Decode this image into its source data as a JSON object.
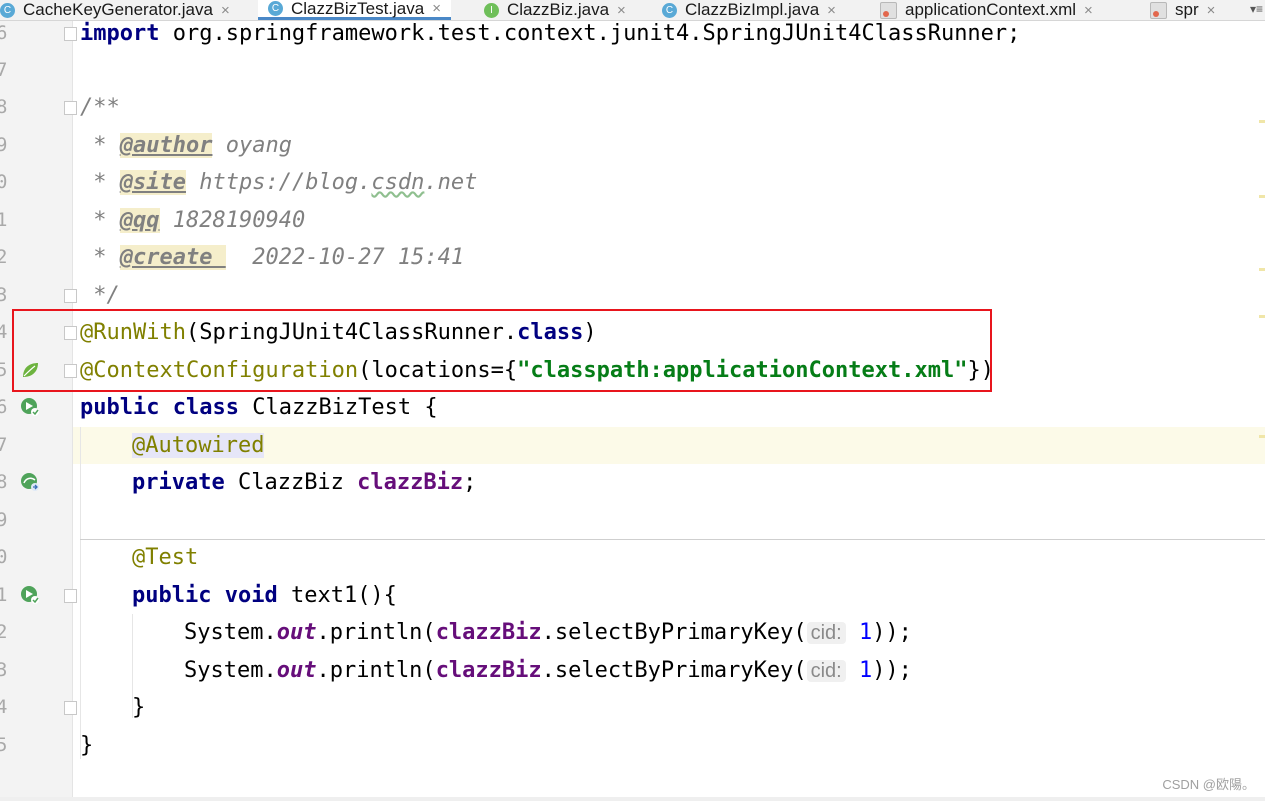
{
  "tabs": [
    {
      "label": "CacheKeyGenerator.java",
      "icon": "class-icon",
      "active": false
    },
    {
      "label": "ClazzBizTest.java",
      "icon": "class-icon",
      "active": true
    },
    {
      "label": "ClazzBiz.java",
      "icon": "interface-icon",
      "active": false
    },
    {
      "label": "ClazzBizImpl.java",
      "icon": "class-icon",
      "active": false
    },
    {
      "label": "applicationContext.xml",
      "icon": "xml-icon",
      "active": false
    },
    {
      "label": "spr",
      "icon": "xml-icon",
      "active": false
    }
  ],
  "tab_close_glyph": "×",
  "tab_menu_glyph": "▾≡",
  "line_numbers": [
    "6",
    "7",
    "8",
    "9",
    "0",
    "1",
    "2",
    "3",
    "4",
    "5",
    "6",
    "7",
    "8",
    "9",
    "0",
    "1",
    "2",
    "3",
    "4",
    "5"
  ],
  "code": {
    "l6": {
      "kw": "import",
      "rest": " org.springframework.test.context.junit4.SpringJUnit4ClassRunner;"
    },
    "l8": "/**",
    "l9": {
      "star": " * ",
      "tag": "@author",
      "val": " oyang"
    },
    "l10": {
      "star": " * ",
      "tag": "@site",
      "val": " https://blog.",
      "wavy": "csdn",
      "val2": ".net"
    },
    "l11": {
      "star": " * ",
      "tag": "@qq",
      "val": " 1828190940"
    },
    "l12": {
      "star": " * ",
      "tag": "@create ",
      "val": "  2022-10-27 15:41"
    },
    "l13": " */",
    "l14": {
      "ann": "@RunWith",
      "p1": "(SpringJUnit4ClassRunner.",
      "kw": "class",
      "p2": ")"
    },
    "l15": {
      "ann": "@ContextConfiguration",
      "p1": "(locations={",
      "str": "\"classpath:applicationContext.xml\"",
      "p2": "})"
    },
    "l16": {
      "kw1": "public",
      "kw2": "class",
      "rest": " ClazzBizTest {"
    },
    "l17": {
      "ann": "@Autowired"
    },
    "l18": {
      "kw": "private",
      "type": " ClazzBiz ",
      "fld": "clazzBiz",
      "end": ";"
    },
    "l20": {
      "ann": "@Test"
    },
    "l21": {
      "kw1": "public",
      "kw2": "void",
      "rest": " text1(){"
    },
    "l22": {
      "p1": "System.",
      "static": "out",
      "p2": ".println(",
      "fld": "clazzBiz",
      "p3": ".selectByPrimaryKey(",
      "hint": "cid:",
      "num": "1",
      "p4": "));"
    },
    "l23": {
      "p1": "System.",
      "static": "out",
      "p2": ".println(",
      "fld": "clazzBiz",
      "p3": ".selectByPrimaryKey(",
      "hint": "cid:",
      "num": "1",
      "p4": "));"
    },
    "l24": "}",
    "l25": "}"
  },
  "watermark": "CSDN @欧陽。",
  "colors": {
    "highlight_box": "#e8151d",
    "keyword": "#000080",
    "annotation": "#808000",
    "string": "#067d17",
    "field": "#660e7a"
  }
}
